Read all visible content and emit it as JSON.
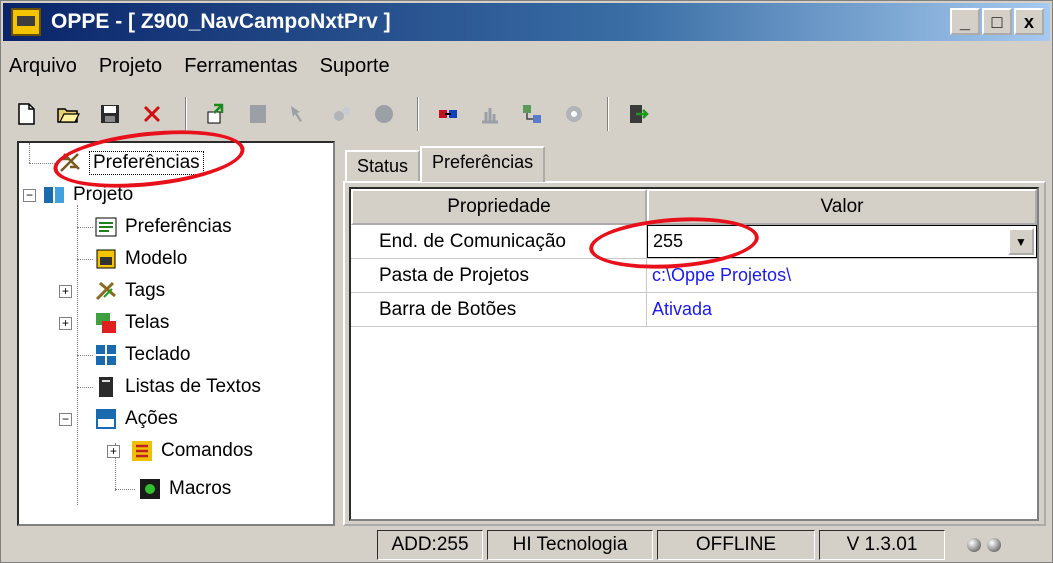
{
  "window": {
    "title": "OPPE - [ Z900_NavCampoNxtPrv ]",
    "controls": {
      "minimize": "_",
      "maximize": "□",
      "close": "x"
    }
  },
  "menu": [
    {
      "label": "Arquivo"
    },
    {
      "label": "Projeto"
    },
    {
      "label": "Ferramentas"
    },
    {
      "label": "Suporte"
    }
  ],
  "toolbar": {
    "icons": [
      "new-file-icon",
      "open-folder-icon",
      "save-icon",
      "delete-icon",
      "import-icon",
      "screen-icon",
      "tags-icon",
      "connect-icon",
      "record-icon",
      "compile-icon",
      "transfer-icon",
      "network-icon",
      "settings-icon",
      "exit-icon"
    ]
  },
  "tree": {
    "items": [
      {
        "label": "Preferências",
        "icon": "preferences-tool-icon"
      },
      {
        "label": "Projeto",
        "icon": "project-icon"
      },
      {
        "label": "Preferências",
        "icon": "preferences-list-icon"
      },
      {
        "label": "Modelo",
        "icon": "model-icon"
      },
      {
        "label": "Tags",
        "icon": "tags-icon"
      },
      {
        "label": "Telas",
        "icon": "screens-icon"
      },
      {
        "label": "Teclado",
        "icon": "keyboard-icon"
      },
      {
        "label": "Listas de Textos",
        "icon": "text-lists-icon"
      },
      {
        "label": "Ações",
        "icon": "actions-icon"
      },
      {
        "label": "Comandos",
        "icon": "commands-icon"
      },
      {
        "label": "Macros",
        "icon": "macros-icon"
      }
    ]
  },
  "tabs": [
    {
      "label": "Status"
    },
    {
      "label": "Preferências"
    }
  ],
  "grid": {
    "headers": [
      "Propriedade",
      "Valor"
    ],
    "rows": [
      {
        "property": "End. de Comunicação",
        "value": "255"
      },
      {
        "property": "Pasta de Projetos",
        "value": "c:\\Oppe  Projetos\\"
      },
      {
        "property": "Barra de Botões",
        "value": "Ativada"
      }
    ]
  },
  "statusbar": {
    "address": "ADD:255",
    "company": "HI Tecnologia",
    "connection": "OFFLINE",
    "version": "V 1.3.01"
  },
  "colors": {
    "titlebar_start": "#0a246a",
    "titlebar_end": "#a6caf0",
    "annotation": "#e8101a",
    "value_link": "#1a1af0"
  }
}
